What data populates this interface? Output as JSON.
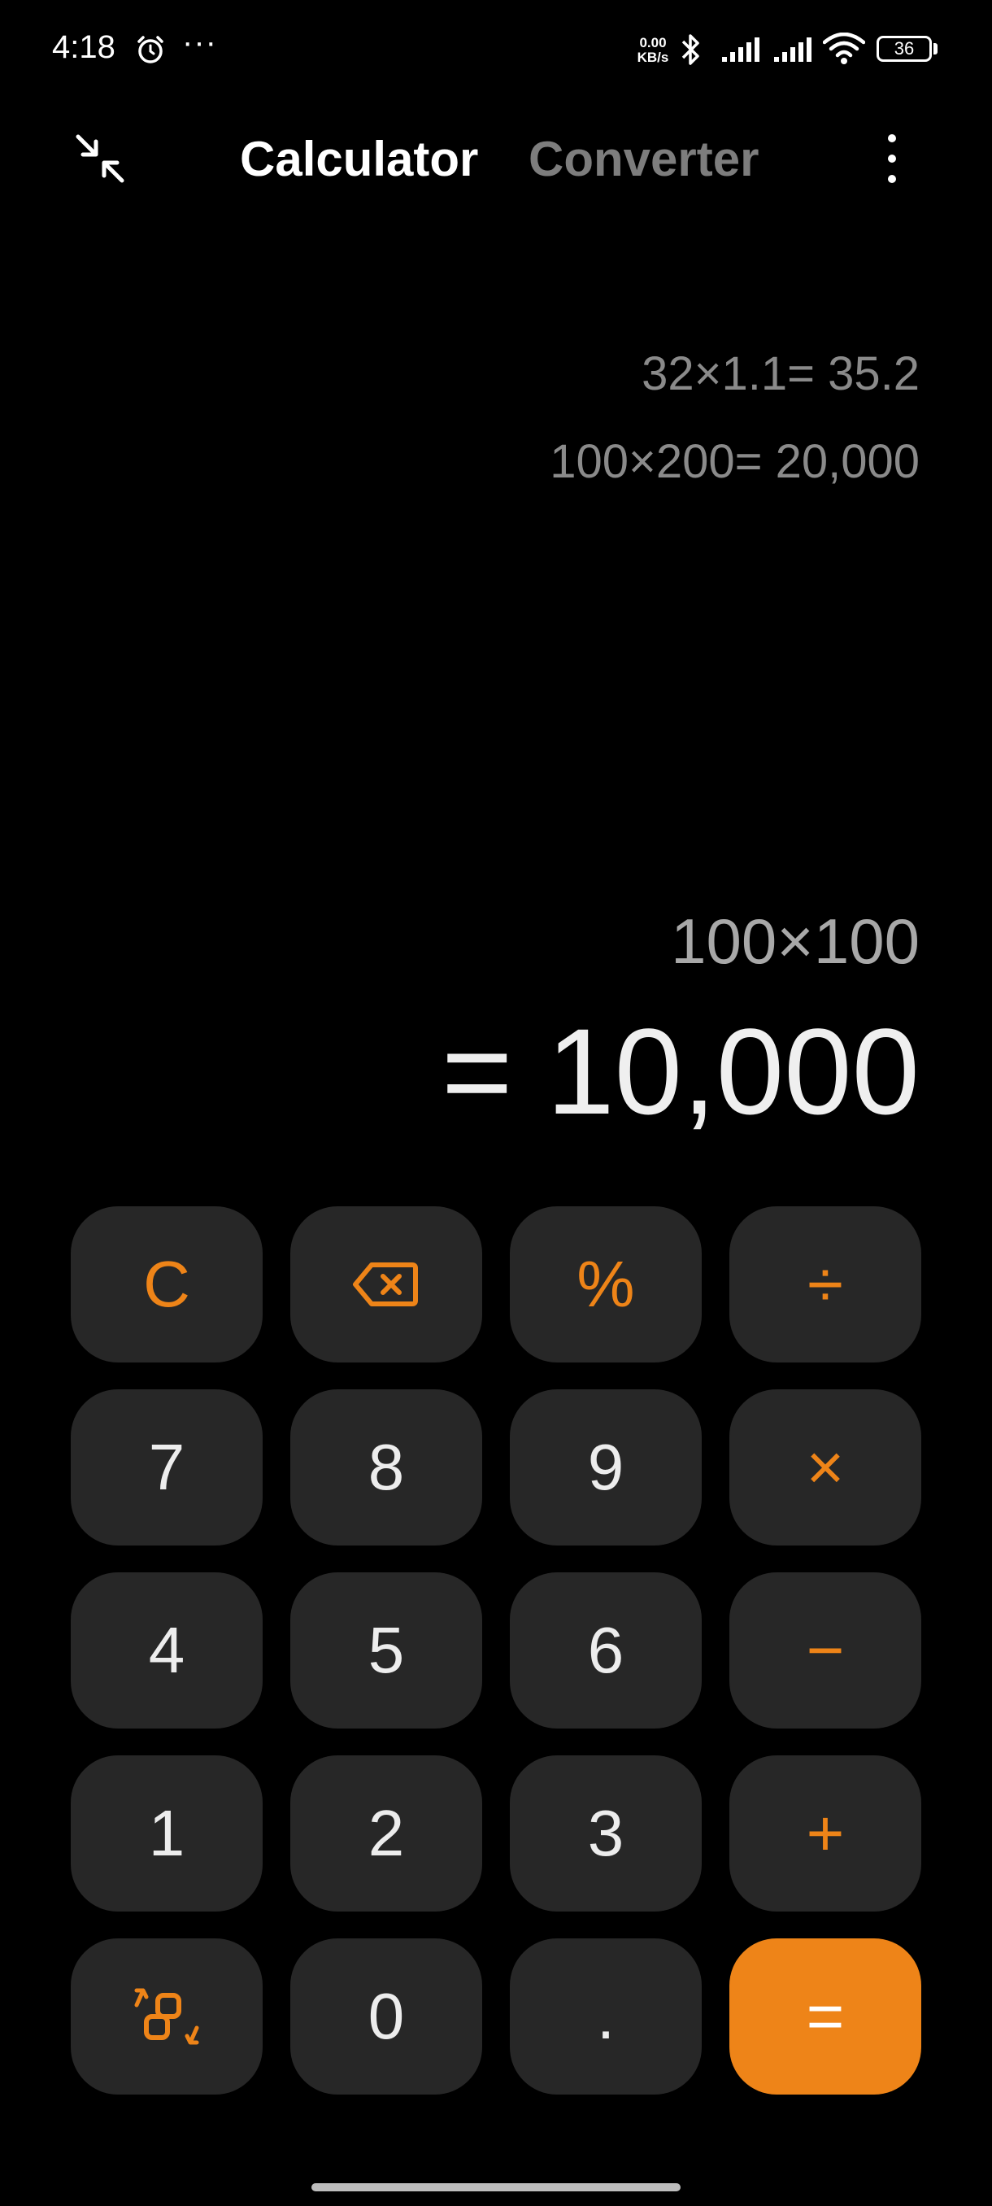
{
  "status_bar": {
    "time": "4:18",
    "more": "···",
    "speed_value": "0.00",
    "speed_unit": "KB/s",
    "battery": "36",
    "icons": [
      "alarm-icon",
      "bluetooth-icon",
      "signal-icon",
      "signal-icon",
      "wifi-icon",
      "battery-icon"
    ]
  },
  "header": {
    "collapse_icon": "collapse-arrows-icon",
    "tabs": [
      {
        "label": "Calculator",
        "active": true
      },
      {
        "label": "Converter",
        "active": false
      }
    ],
    "menu_icon": "more-vertical-icon"
  },
  "history": [
    "32×1.1= 35.2",
    "100×200= 20,000"
  ],
  "display": {
    "expression": "100×100",
    "result": "= 10,000"
  },
  "keypad": {
    "rows": [
      [
        {
          "id": "clear",
          "label": "C",
          "type": "op"
        },
        {
          "id": "backspace",
          "label": "",
          "icon": "backspace-icon",
          "type": "op"
        },
        {
          "id": "percent",
          "label": "%",
          "type": "op"
        },
        {
          "id": "divide",
          "label": "÷",
          "type": "op"
        }
      ],
      [
        {
          "id": "7",
          "label": "7",
          "type": "digit"
        },
        {
          "id": "8",
          "label": "8",
          "type": "digit"
        },
        {
          "id": "9",
          "label": "9",
          "type": "digit"
        },
        {
          "id": "multiply",
          "label": "×",
          "type": "op"
        }
      ],
      [
        {
          "id": "4",
          "label": "4",
          "type": "digit"
        },
        {
          "id": "5",
          "label": "5",
          "type": "digit"
        },
        {
          "id": "6",
          "label": "6",
          "type": "digit"
        },
        {
          "id": "minus",
          "label": "−",
          "type": "op"
        }
      ],
      [
        {
          "id": "1",
          "label": "1",
          "type": "digit"
        },
        {
          "id": "2",
          "label": "2",
          "type": "digit"
        },
        {
          "id": "3",
          "label": "3",
          "type": "digit"
        },
        {
          "id": "plus",
          "label": "+",
          "type": "op"
        }
      ],
      [
        {
          "id": "switch-mode",
          "label": "",
          "icon": "switch-mode-icon",
          "type": "op"
        },
        {
          "id": "0",
          "label": "0",
          "type": "digit"
        },
        {
          "id": "decimal",
          "label": ".",
          "type": "digit"
        },
        {
          "id": "equals",
          "label": "=",
          "type": "equals"
        }
      ]
    ]
  },
  "colors": {
    "background": "#000000",
    "key_background": "#272727",
    "accent": "#ee8418",
    "history_text": "#8a8a8a",
    "expression_text": "#a8a8a8",
    "result_text": "#efefef"
  }
}
